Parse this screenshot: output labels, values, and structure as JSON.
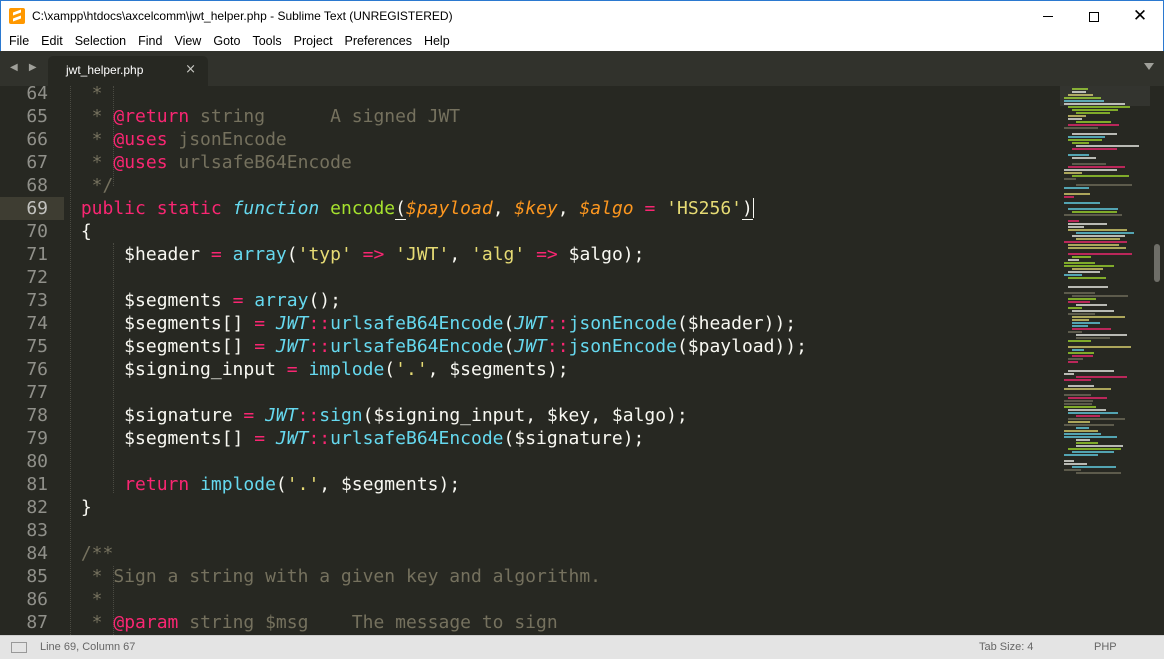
{
  "window": {
    "title": "C:\\xampp\\htdocs\\axcelcomm\\jwt_helper.php - Sublime Text (UNREGISTERED)",
    "minimize_icon": "minimize-icon",
    "maximize_icon": "maximize-icon",
    "close_icon": "close-icon"
  },
  "menu": [
    "File",
    "Edit",
    "Selection",
    "Find",
    "View",
    "Goto",
    "Tools",
    "Project",
    "Preferences",
    "Help"
  ],
  "tabs": [
    {
      "label": "jwt_helper.php",
      "close": "×"
    }
  ],
  "tab_nav": "◀ ▶",
  "editor": {
    "line_numbers": [
      "64",
      "65",
      "66",
      "67",
      "68",
      "69",
      "70",
      "71",
      "72",
      "73",
      "74",
      "75",
      "76",
      "77",
      "78",
      "79",
      "80",
      "81",
      "82",
      "83",
      "84",
      "85",
      "86",
      "87"
    ],
    "active_line": "69",
    "lines": [
      [
        {
          "t": "  *",
          "c": "t-com"
        }
      ],
      [
        {
          "t": "  * ",
          "c": "t-com"
        },
        {
          "t": "@return",
          "c": "t-tag"
        },
        {
          "t": " string      A signed JWT",
          "c": "t-com"
        }
      ],
      [
        {
          "t": "  * ",
          "c": "t-com"
        },
        {
          "t": "@uses",
          "c": "t-tag"
        },
        {
          "t": " jsonEncode",
          "c": "t-com"
        }
      ],
      [
        {
          "t": "  * ",
          "c": "t-com"
        },
        {
          "t": "@uses",
          "c": "t-tag"
        },
        {
          "t": " urlsafeB64Encode",
          "c": "t-com"
        }
      ],
      [
        {
          "t": "  */",
          "c": "t-com"
        }
      ],
      [
        {
          "t": " public",
          "c": "t-kw"
        },
        {
          "t": " ",
          "c": "t-var"
        },
        {
          "t": "static",
          "c": "t-kw"
        },
        {
          "t": " ",
          "c": "t-var"
        },
        {
          "t": "function",
          "c": "t-st"
        },
        {
          "t": " ",
          "c": "t-var"
        },
        {
          "t": "encode",
          "c": "t-fn"
        },
        {
          "t": "(",
          "c": "t-var paren-hl"
        },
        {
          "t": "$payload",
          "c": "t-arg"
        },
        {
          "t": ", ",
          "c": "t-var"
        },
        {
          "t": "$key",
          "c": "t-arg"
        },
        {
          "t": ", ",
          "c": "t-var"
        },
        {
          "t": "$algo",
          "c": "t-arg"
        },
        {
          "t": " = ",
          "c": "t-op"
        },
        {
          "t": "'HS256'",
          "c": "t-str"
        },
        {
          "t": ")",
          "c": "t-var paren-hl"
        }
      ],
      [
        {
          "t": " {",
          "c": "t-var"
        }
      ],
      [
        {
          "t": "     $header ",
          "c": "t-var"
        },
        {
          "t": "=",
          "c": "t-op"
        },
        {
          "t": " ",
          "c": "t-var"
        },
        {
          "t": "array",
          "c": "t-bi"
        },
        {
          "t": "(",
          "c": "t-var"
        },
        {
          "t": "'typ'",
          "c": "t-str"
        },
        {
          "t": " ",
          "c": "t-var"
        },
        {
          "t": "=>",
          "c": "t-op"
        },
        {
          "t": " ",
          "c": "t-var"
        },
        {
          "t": "'JWT'",
          "c": "t-str"
        },
        {
          "t": ", ",
          "c": "t-var"
        },
        {
          "t": "'alg'",
          "c": "t-str"
        },
        {
          "t": " ",
          "c": "t-var"
        },
        {
          "t": "=>",
          "c": "t-op"
        },
        {
          "t": " $algo);",
          "c": "t-var"
        }
      ],
      [
        {
          "t": "",
          "c": "t-var"
        }
      ],
      [
        {
          "t": "     $segments ",
          "c": "t-var"
        },
        {
          "t": "=",
          "c": "t-op"
        },
        {
          "t": " ",
          "c": "t-var"
        },
        {
          "t": "array",
          "c": "t-bi"
        },
        {
          "t": "();",
          "c": "t-var"
        }
      ],
      [
        {
          "t": "     $segments[] ",
          "c": "t-var"
        },
        {
          "t": "=",
          "c": "t-op"
        },
        {
          "t": " ",
          "c": "t-var"
        },
        {
          "t": "JWT",
          "c": "t-st"
        },
        {
          "t": "::",
          "c": "t-op"
        },
        {
          "t": "urlsafeB64Encode",
          "c": "t-bi"
        },
        {
          "t": "(",
          "c": "t-var"
        },
        {
          "t": "JWT",
          "c": "t-st"
        },
        {
          "t": "::",
          "c": "t-op"
        },
        {
          "t": "jsonEncode",
          "c": "t-bi"
        },
        {
          "t": "($header));",
          "c": "t-var"
        }
      ],
      [
        {
          "t": "     $segments[] ",
          "c": "t-var"
        },
        {
          "t": "=",
          "c": "t-op"
        },
        {
          "t": " ",
          "c": "t-var"
        },
        {
          "t": "JWT",
          "c": "t-st"
        },
        {
          "t": "::",
          "c": "t-op"
        },
        {
          "t": "urlsafeB64Encode",
          "c": "t-bi"
        },
        {
          "t": "(",
          "c": "t-var"
        },
        {
          "t": "JWT",
          "c": "t-st"
        },
        {
          "t": "::",
          "c": "t-op"
        },
        {
          "t": "jsonEncode",
          "c": "t-bi"
        },
        {
          "t": "($payload));",
          "c": "t-var"
        }
      ],
      [
        {
          "t": "     $signing_input ",
          "c": "t-var"
        },
        {
          "t": "=",
          "c": "t-op"
        },
        {
          "t": " ",
          "c": "t-var"
        },
        {
          "t": "implode",
          "c": "t-bi"
        },
        {
          "t": "(",
          "c": "t-var"
        },
        {
          "t": "'.'",
          "c": "t-str"
        },
        {
          "t": ", $segments);",
          "c": "t-var"
        }
      ],
      [
        {
          "t": "",
          "c": "t-var"
        }
      ],
      [
        {
          "t": "     $signature ",
          "c": "t-var"
        },
        {
          "t": "=",
          "c": "t-op"
        },
        {
          "t": " ",
          "c": "t-var"
        },
        {
          "t": "JWT",
          "c": "t-st"
        },
        {
          "t": "::",
          "c": "t-op"
        },
        {
          "t": "sign",
          "c": "t-bi"
        },
        {
          "t": "($signing_input, $key, $algo);",
          "c": "t-var"
        }
      ],
      [
        {
          "t": "     $segments[] ",
          "c": "t-var"
        },
        {
          "t": "=",
          "c": "t-op"
        },
        {
          "t": " ",
          "c": "t-var"
        },
        {
          "t": "JWT",
          "c": "t-st"
        },
        {
          "t": "::",
          "c": "t-op"
        },
        {
          "t": "urlsafeB64Encode",
          "c": "t-bi"
        },
        {
          "t": "($signature);",
          "c": "t-var"
        }
      ],
      [
        {
          "t": "",
          "c": "t-var"
        }
      ],
      [
        {
          "t": "     ",
          "c": "t-var"
        },
        {
          "t": "return",
          "c": "t-kw"
        },
        {
          "t": " ",
          "c": "t-var"
        },
        {
          "t": "implode",
          "c": "t-bi"
        },
        {
          "t": "(",
          "c": "t-var"
        },
        {
          "t": "'.'",
          "c": "t-str"
        },
        {
          "t": ", $segments);",
          "c": "t-var"
        }
      ],
      [
        {
          "t": " }",
          "c": "t-var"
        }
      ],
      [
        {
          "t": "",
          "c": "t-var"
        }
      ],
      [
        {
          "t": " /**",
          "c": "t-com"
        }
      ],
      [
        {
          "t": "  * Sign a string with a given key and algorithm.",
          "c": "t-com"
        }
      ],
      [
        {
          "t": "  *",
          "c": "t-com"
        }
      ],
      [
        {
          "t": "  * ",
          "c": "t-com"
        },
        {
          "t": "@param",
          "c": "t-tag"
        },
        {
          "t": " string $msg    The message to sign",
          "c": "t-com"
        }
      ]
    ]
  },
  "status": {
    "position": "Line 69, Column 67",
    "tab_size": "Tab Size: 4",
    "syntax": "PHP"
  },
  "colors": {
    "background": "#272822",
    "comment": "#75715e",
    "keyword": "#f92672",
    "function": "#a6e22e",
    "builtin": "#66d9ef",
    "argument": "#fd971f",
    "string": "#e6db74"
  }
}
